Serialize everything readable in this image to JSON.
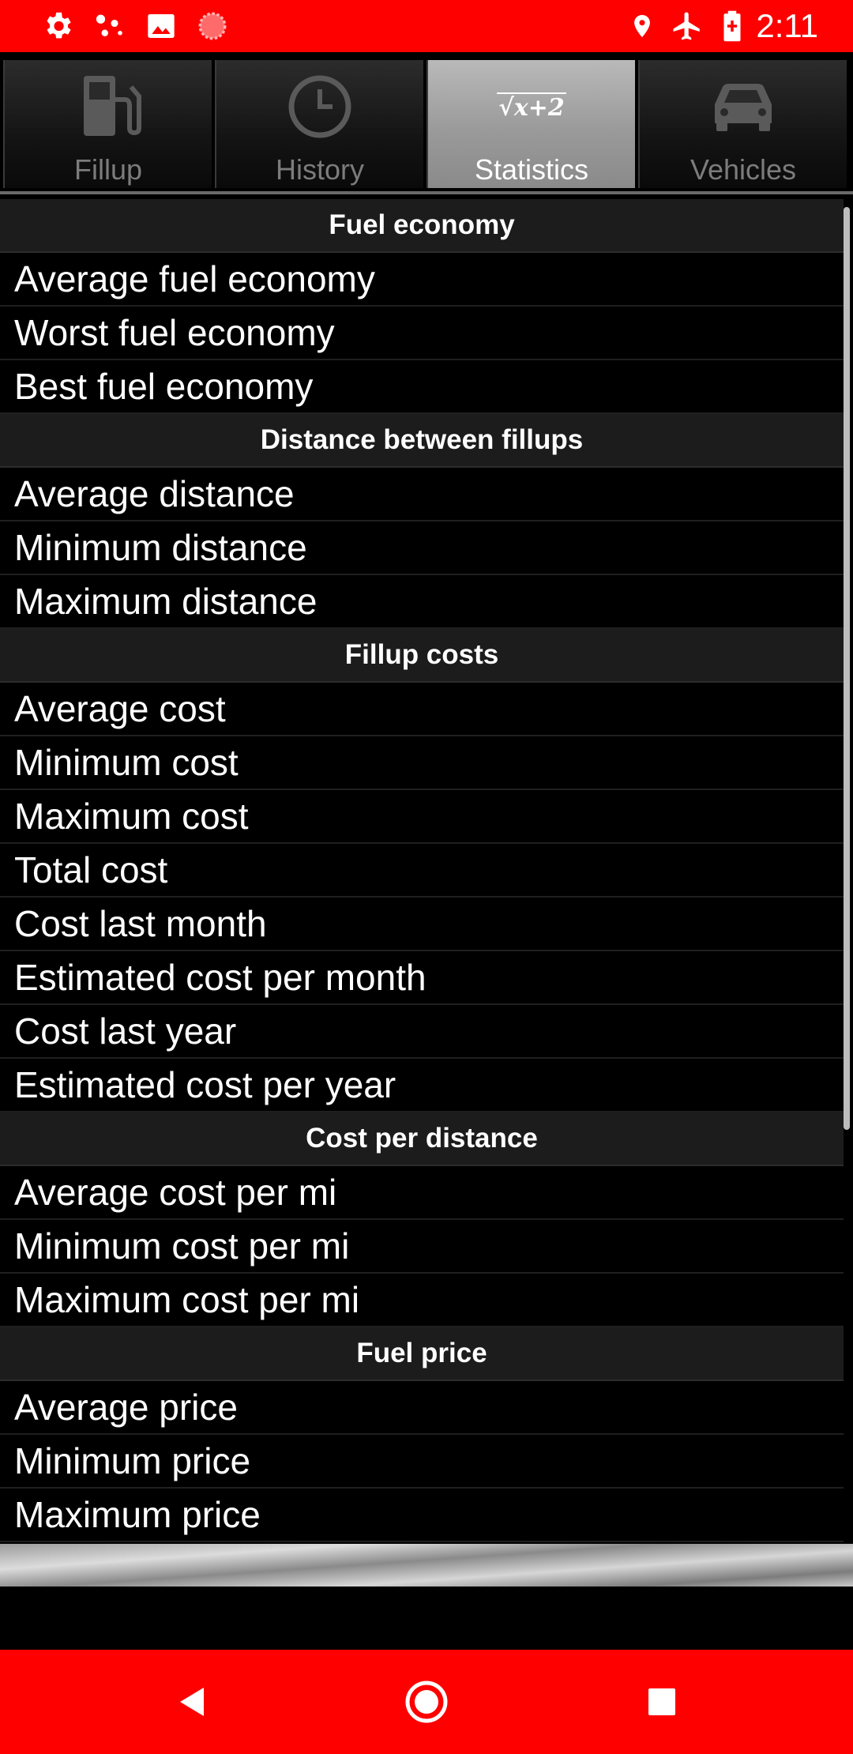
{
  "status_bar": {
    "time": "2:11",
    "left_icons": [
      "settings-icon",
      "notification-dots-icon",
      "image-icon",
      "record-icon"
    ],
    "right_icons": [
      "location-icon",
      "airplane-icon",
      "battery-icon"
    ]
  },
  "tabs": [
    {
      "label": "Fillup",
      "icon": "fuel-pump-icon",
      "active": false
    },
    {
      "label": "History",
      "icon": "clock-icon",
      "active": false
    },
    {
      "label": "Statistics",
      "icon": "sqrt-formula-icon",
      "icon_text": "√x+2",
      "active": true
    },
    {
      "label": "Vehicles",
      "icon": "car-icon",
      "active": false
    }
  ],
  "sections": [
    {
      "title": "Fuel economy",
      "items": [
        "Average fuel economy",
        "Worst fuel economy",
        "Best fuel economy"
      ]
    },
    {
      "title": "Distance between fillups",
      "items": [
        "Average distance",
        "Minimum distance",
        "Maximum distance"
      ]
    },
    {
      "title": "Fillup costs",
      "items": [
        "Average cost",
        "Minimum cost",
        "Maximum cost",
        "Total cost",
        "Cost last month",
        "Estimated cost per month",
        "Cost last year",
        "Estimated cost per year"
      ]
    },
    {
      "title": "Cost per distance",
      "items": [
        "Average cost per mi",
        "Minimum cost per mi",
        "Maximum cost per mi"
      ]
    },
    {
      "title": "Fuel price",
      "items": [
        "Average price",
        "Minimum price",
        "Maximum price"
      ]
    }
  ],
  "colors": {
    "status_bar": "#ff0000",
    "nav_bar": "#ff0000",
    "section_header_bg": "#1c1c1c",
    "active_tab_bg": "#a0a0a0"
  },
  "nav": [
    "back-icon",
    "home-icon",
    "recents-icon"
  ]
}
